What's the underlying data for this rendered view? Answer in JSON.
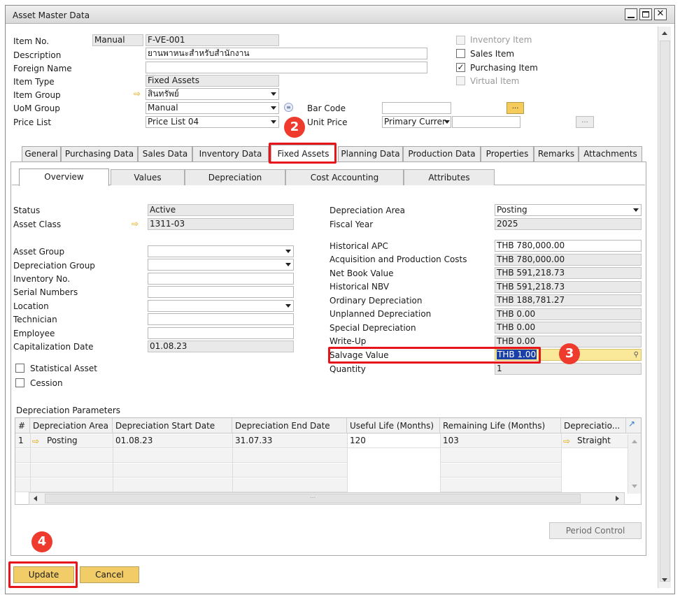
{
  "window": {
    "title": "Asset Master Data",
    "controls": [
      "minimize",
      "maximize",
      "close"
    ]
  },
  "header": {
    "item_no_label": "Item No.",
    "item_no_series": "Manual",
    "item_no_value": "F-VE-001",
    "description_label": "Description",
    "description_value": "ยานพาหนะสำหรับสำนักงาน",
    "foreign_name_label": "Foreign Name",
    "foreign_name_value": "",
    "item_type_label": "Item Type",
    "item_type_value": "Fixed Assets",
    "item_group_label": "Item Group",
    "item_group_value": "สินทรัพย์",
    "uom_group_label": "UoM Group",
    "uom_group_value": "Manual",
    "price_list_label": "Price List",
    "price_list_value": "Price List 04",
    "bar_code_label": "Bar Code",
    "bar_code_value": "",
    "unit_price_label": "Unit Price",
    "unit_price_currency": "Primary Currer",
    "unit_price_value": "",
    "inventory_item_label": "Inventory Item",
    "sales_item_label": "Sales Item",
    "purchasing_item_label": "Purchasing Item",
    "virtual_item_label": "Virtual Item",
    "inventory_item_checked": false,
    "sales_item_checked": false,
    "purchasing_item_checked": true,
    "virtual_item_checked": false,
    "ellipsis": "..."
  },
  "main_tabs": [
    "General",
    "Purchasing Data",
    "Sales Data",
    "Inventory Data",
    "Fixed Assets",
    "Planning Data",
    "Production Data",
    "Properties",
    "Remarks",
    "Attachments"
  ],
  "active_main_tab": "Fixed Assets",
  "sub_tabs": [
    "Overview",
    "Values",
    "Depreciation",
    "Cost Accounting",
    "Attributes"
  ],
  "active_sub_tab": "Overview",
  "overview_left": {
    "status_label": "Status",
    "status_value": "Active",
    "asset_class_label": "Asset Class",
    "asset_class_value": "1311-03",
    "asset_group_label": "Asset Group",
    "asset_group_value": "",
    "depreciation_group_label": "Depreciation Group",
    "depreciation_group_value": "",
    "inventory_no_label": "Inventory No.",
    "inventory_no_value": "",
    "serial_numbers_label": "Serial Numbers",
    "serial_numbers_value": "",
    "location_label": "Location",
    "location_value": "",
    "technician_label": "Technician",
    "technician_value": "",
    "employee_label": "Employee",
    "employee_value": "",
    "capitalization_date_label": "Capitalization Date",
    "capitalization_date_value": "01.08.23",
    "statistical_asset_label": "Statistical Asset",
    "cession_label": "Cession"
  },
  "overview_right": {
    "depreciation_area_label": "Depreciation Area",
    "depreciation_area_value": "Posting",
    "fiscal_year_label": "Fiscal Year",
    "fiscal_year_value": "2025",
    "historical_apc_label": "Historical APC",
    "historical_apc_value": "THB 780,000.00",
    "acq_prod_costs_label": "Acquisition and Production Costs",
    "acq_prod_costs_value": "THB 780,000.00",
    "net_book_value_label": "Net Book Value",
    "net_book_value_value": "THB 591,218.73",
    "historical_nbv_label": "Historical NBV",
    "historical_nbv_value": "THB 591,218.73",
    "ordinary_depreciation_label": "Ordinary Depreciation",
    "ordinary_depreciation_value": "THB 188,781.27",
    "unplanned_depreciation_label": "Unplanned Depreciation",
    "unplanned_depreciation_value": "THB 0.00",
    "special_depreciation_label": "Special Depreciation",
    "special_depreciation_value": "THB 0.00",
    "write_up_label": "Write-Up",
    "write_up_value": "THB 0.00",
    "salvage_value_label": "Salvage Value",
    "salvage_value_value": "THB 1.00",
    "quantity_label": "Quantity",
    "quantity_value": "1"
  },
  "depreciation_params": {
    "title": "Depreciation Parameters",
    "columns": [
      "#",
      "Depreciation Area",
      "Depreciation Start Date",
      "Depreciation End Date",
      "Useful Life (Months)",
      "Remaining Life (Months)",
      "Depreciatio..."
    ],
    "rows": [
      [
        "1",
        "Posting",
        "01.08.23",
        "31.07.33",
        "120",
        "103",
        "Straight"
      ]
    ]
  },
  "buttons": {
    "period_control": "Period Control",
    "update": "Update",
    "cancel": "Cancel"
  },
  "annotations": {
    "badge_2": "2",
    "badge_3": "3",
    "badge_4": "4"
  },
  "colors": {
    "accent_button": "#f2cc66",
    "highlight_field": "#fbe99a",
    "selection": "#1a3fa8",
    "annotation_red": "#e8141b"
  }
}
